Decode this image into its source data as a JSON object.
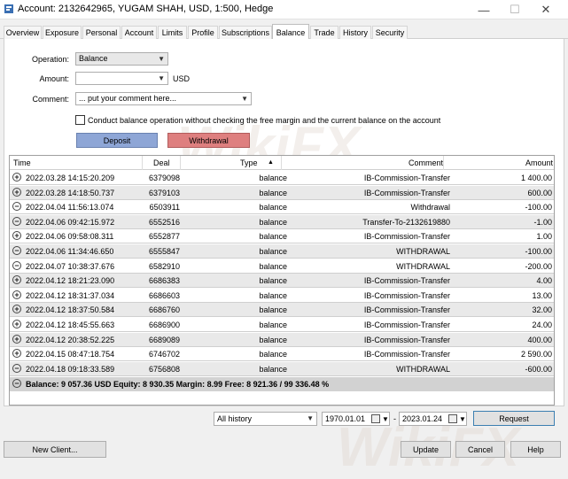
{
  "window": {
    "title": "Account: 2132642965, YUGAM SHAH, USD, 1:500, Hedge",
    "controls": {
      "minimize": "—",
      "maximize": "☐",
      "close": "✕"
    }
  },
  "tabs": [
    {
      "label": "Overview"
    },
    {
      "label": "Exposure"
    },
    {
      "label": "Personal"
    },
    {
      "label": "Account"
    },
    {
      "label": "Limits"
    },
    {
      "label": "Profile"
    },
    {
      "label": "Subscriptions"
    },
    {
      "label": "Balance",
      "active": true
    },
    {
      "label": "Trade"
    },
    {
      "label": "History"
    },
    {
      "label": "Security"
    }
  ],
  "form": {
    "operation_label": "Operation:",
    "operation_value": "Balance",
    "amount_label": "Amount:",
    "amount_value": "",
    "amount_unit": "USD",
    "comment_label": "Comment:",
    "comment_placeholder": "... put your comment here...",
    "checkbox_label": "Conduct balance operation without checking the free margin and the current balance on the account",
    "checkbox_checked": false,
    "deposit_label": "Deposit",
    "withdrawal_label": "Withdrawal"
  },
  "table": {
    "columns": {
      "time": "Time",
      "deal": "Deal",
      "type": "Type",
      "sort_indicator": "▲",
      "comment": "Comment",
      "amount": "Amount"
    },
    "rows": [
      {
        "icon": "+",
        "time": "2022.03.28 14:15:20.209",
        "deal": "6379098",
        "type": "balance",
        "comment": "IB-Commission-Transfer",
        "amount": "1 400.00"
      },
      {
        "icon": "+",
        "time": "2022.03.28 14:18:50.737",
        "deal": "6379103",
        "type": "balance",
        "comment": "IB-Commission-Transfer",
        "amount": "600.00"
      },
      {
        "icon": "−",
        "time": "2022.04.04 11:56:13.074",
        "deal": "6503911",
        "type": "balance",
        "comment": "Withdrawal",
        "amount": "-100.00"
      },
      {
        "icon": "−",
        "time": "2022.04.06 09:42:15.972",
        "deal": "6552516",
        "type": "balance",
        "comment": "Transfer-To-2132619880",
        "amount": "-1.00"
      },
      {
        "icon": "+",
        "time": "2022.04.06 09:58:08.311",
        "deal": "6552877",
        "type": "balance",
        "comment": "IB-Commission-Transfer",
        "amount": "1.00"
      },
      {
        "icon": "−",
        "time": "2022.04.06 11:34:46.650",
        "deal": "6555847",
        "type": "balance",
        "comment": "WITHDRAWAL",
        "amount": "-100.00"
      },
      {
        "icon": "−",
        "time": "2022.04.07 10:38:37.676",
        "deal": "6582910",
        "type": "balance",
        "comment": "WITHDRAWAL",
        "amount": "-200.00"
      },
      {
        "icon": "+",
        "time": "2022.04.12 18:21:23.090",
        "deal": "6686383",
        "type": "balance",
        "comment": "IB-Commission-Transfer",
        "amount": "4.00"
      },
      {
        "icon": "+",
        "time": "2022.04.12 18:31:37.034",
        "deal": "6686603",
        "type": "balance",
        "comment": "IB-Commission-Transfer",
        "amount": "13.00"
      },
      {
        "icon": "+",
        "time": "2022.04.12 18:37:50.584",
        "deal": "6686760",
        "type": "balance",
        "comment": "IB-Commission-Transfer",
        "amount": "32.00"
      },
      {
        "icon": "+",
        "time": "2022.04.12 18:45:55.663",
        "deal": "6686900",
        "type": "balance",
        "comment": "IB-Commission-Transfer",
        "amount": "24.00"
      },
      {
        "icon": "+",
        "time": "2022.04.12 20:38:52.225",
        "deal": "6689089",
        "type": "balance",
        "comment": "IB-Commission-Transfer",
        "amount": "400.00"
      },
      {
        "icon": "+",
        "time": "2022.04.15 08:47:18.754",
        "deal": "6746702",
        "type": "balance",
        "comment": "IB-Commission-Transfer",
        "amount": "2 590.00"
      },
      {
        "icon": "−",
        "time": "2022.04.18 09:18:33.589",
        "deal": "6756808",
        "type": "balance",
        "comment": "WITHDRAWAL",
        "amount": "-600.00"
      }
    ],
    "summary_icon": "−",
    "summary": "Balance: 9 057.36 USD  Equity: 8 930.35  Margin: 8.99  Free: 8 921.36 / 99 336.48 %"
  },
  "filter": {
    "period": "All history",
    "from_date": "1970.01.01",
    "to_date": "2023.01.24",
    "separator": "-",
    "request_label": "Request"
  },
  "buttons": {
    "new_client": "New Client...",
    "update": "Update",
    "cancel": "Cancel",
    "help": "Help"
  },
  "watermark": "WikiFX",
  "colors": {
    "deposit": "#8ea6d6",
    "withdrawal": "#de7f7f",
    "row_alt": "#e9e9e9",
    "summary_bg": "#d2d2d2"
  }
}
